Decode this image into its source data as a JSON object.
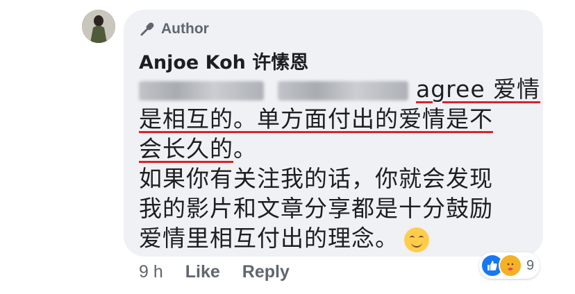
{
  "comment": {
    "author_badge": "Author",
    "author_name": "Anjoe Koh 许愫恩",
    "lines": {
      "l1_tail": "agree 爱情",
      "l2": "是相互的。单方面付出的爱情是不",
      "l3_underlined": "会长久的",
      "l3_tail": "。",
      "l4": "如果你有关注我的话，你就会发现",
      "l5": "我的影片和文章分享都是十分鼓励",
      "l6": "爱情里相互付出的理念。"
    }
  },
  "actions": {
    "time": "9 h",
    "like_label": "Like",
    "reply_label": "Reply"
  },
  "reactions": {
    "icons": [
      "like-icon",
      "care-icon"
    ],
    "count": "9"
  },
  "colors": {
    "bubble": "#eff1f4",
    "underline": "#d8232a",
    "like_blue": "#1877f2"
  }
}
